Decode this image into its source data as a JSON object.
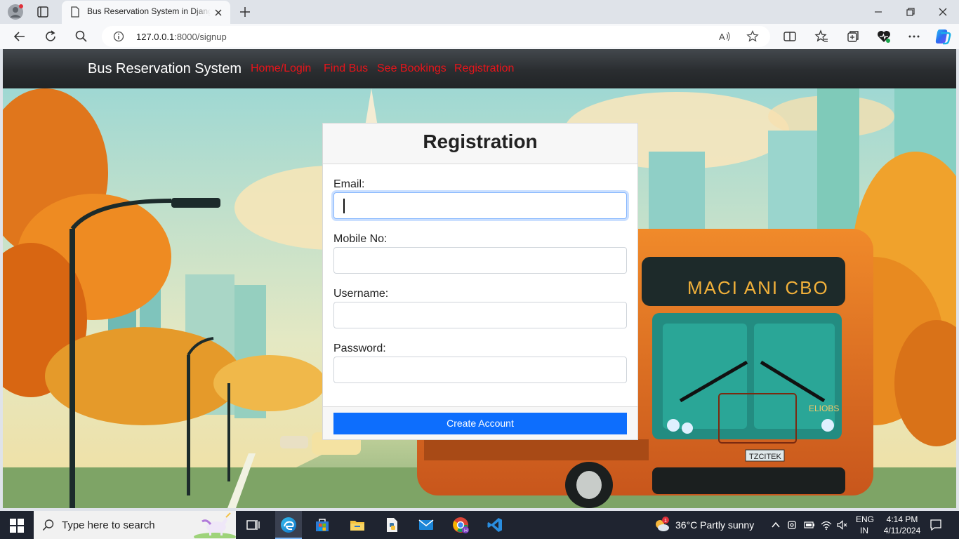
{
  "browser": {
    "tab_title": "Bus Reservation System in Django",
    "url_host": "127.0.0.1",
    "url_rest": ":8000/signup"
  },
  "navbar": {
    "brand": "Bus Reservation System",
    "links": [
      "Home/Login",
      "Find Bus",
      "See Bookings",
      "Registration"
    ],
    "link_color": "#e8141a"
  },
  "form": {
    "title": "Registration",
    "fields": [
      {
        "label": "Email:",
        "value": ""
      },
      {
        "label": "Mobile No:",
        "value": ""
      },
      {
        "label": "Username:",
        "value": ""
      },
      {
        "label": "Password:",
        "value": ""
      }
    ],
    "submit_label": "Create Account",
    "submit_color": "#0d6efd"
  },
  "background": {
    "bus_sign": "MACI ANI CBO",
    "bus_plate": "TZCITEK",
    "bus_side": "ELIOBS"
  },
  "taskbar": {
    "search_placeholder": "Type here to search",
    "weather": "36°C  Partly sunny",
    "weather_badge": "1",
    "lang_line1": "ENG",
    "lang_line2": "IN",
    "time": "4:14 PM",
    "date": "4/11/2024"
  }
}
